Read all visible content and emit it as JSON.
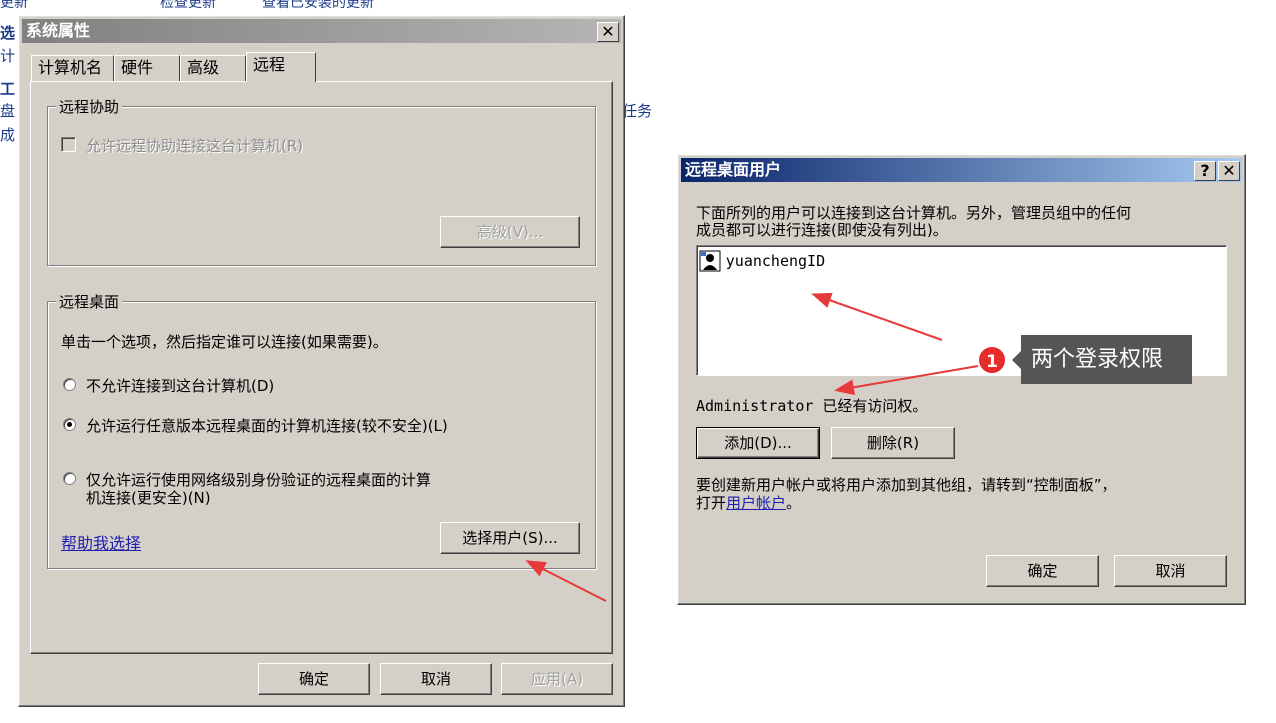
{
  "background": {
    "top_links": [
      "更新",
      "检查更新",
      "查看已安装的更新"
    ],
    "left_fragments": [
      "选",
      "计",
      "工",
      "盘",
      "成"
    ],
    "task_fragment": "任务"
  },
  "sysprops": {
    "title": "系统属性",
    "close": "✕",
    "tabs": [
      "计算机名",
      "硬件",
      "高级",
      "远程"
    ],
    "remote_assist": {
      "group_label": "远程协助",
      "checkbox_label": "允许远程协助连接这台计算机(R)",
      "advanced_btn": "高级(V)..."
    },
    "remote_desktop": {
      "group_label": "远程桌面",
      "instruction": "单击一个选项，然后指定谁可以连接(如果需要)。",
      "opt1": "不允许连接到这台计算机(D)",
      "opt2": "允许运行任意版本远程桌面的计算机连接(较不安全)(L)",
      "opt3_line1": "仅允许运行使用网络级别身份验证的远程桌面的计算",
      "opt3_line2": "机连接(更安全)(N)",
      "help_link": "帮助我选择",
      "select_users_btn": "选择用户(S)..."
    },
    "ok": "确定",
    "cancel": "取消",
    "apply": "应用(A)"
  },
  "rdusers": {
    "title": "远程桌面用户",
    "help_btn": "?",
    "close": "✕",
    "desc_line1": "下面所列的用户可以连接到这台计算机。另外，管理员组中的任何",
    "desc_line2": "成员都可以进行连接(即使没有列出)。",
    "users": [
      "yuanchengID"
    ],
    "admin_note": "Administrator 已经有访问权。",
    "add_btn": "添加(D)...",
    "remove_btn": "删除(R)",
    "footer_line1": "要创建新用户帐户或将用户添加到其他组，请转到“控制面板”，",
    "footer_line2_prefix": "打开",
    "footer_link": "用户帐户",
    "footer_line2_suffix": "。",
    "ok": "确定",
    "cancel": "取消"
  },
  "annotation": {
    "badge": "1",
    "callout": "两个登录权限",
    "arrow_color": "#e83a3a"
  }
}
